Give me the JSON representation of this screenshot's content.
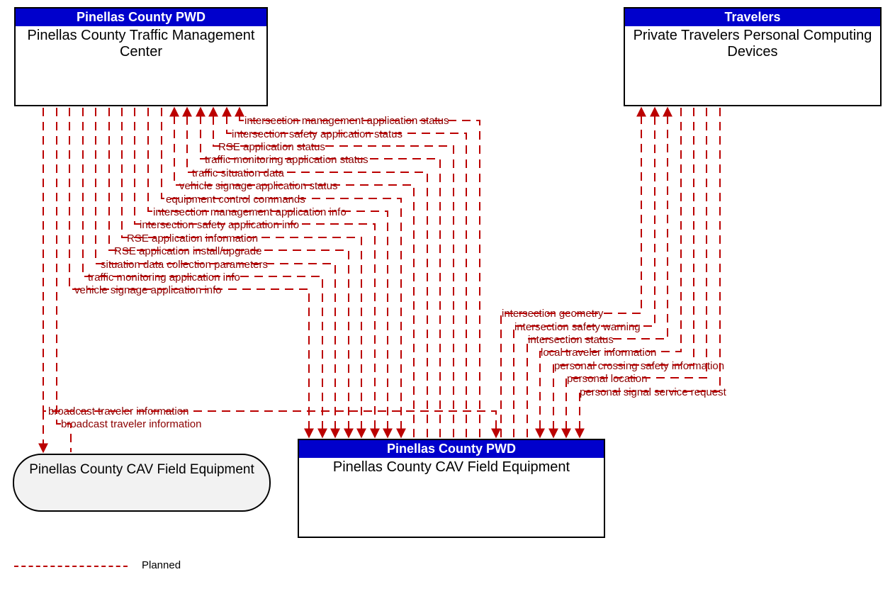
{
  "entities": {
    "tmc": {
      "header": "Pinellas County PWD",
      "title": "Pinellas County Traffic Management Center"
    },
    "travelers": {
      "header": "Travelers",
      "title": "Private Travelers Personal Computing Devices"
    },
    "cav_field_box": {
      "header": "Pinellas County PWD",
      "title": "Pinellas County CAV Field Equipment"
    },
    "cav_field_oval": {
      "title": "Pinellas County CAV Field Equipment"
    }
  },
  "flows_tmc_cav": {
    "up1": "intersection management application status",
    "up2": "intersection safety application status",
    "up3": "RSE application status",
    "up4": "traffic monitoring application status",
    "up5": "traffic situation data",
    "up6": "vehicle signage application status",
    "down1": "equipment control commands",
    "down2": "intersection management application info",
    "down3": "intersection safety application info",
    "down4": "RSE application information",
    "down5": "RSE application install/upgrade",
    "down6": "situation data collection parameters",
    "down7": "traffic monitoring application info",
    "down8": "vehicle signage application info"
  },
  "flows_trav_cav": {
    "up1": "intersection geometry",
    "up2": "intersection safety warning",
    "up3": "intersection status",
    "down1": "local traveler information",
    "down2": "personal crossing safety information",
    "down3": "personal location",
    "down4": "personal signal service request"
  },
  "flows_broadcast": {
    "b1": "broadcast traveler information",
    "b2": "broadcast traveler information"
  },
  "legend": {
    "planned": "Planned"
  }
}
